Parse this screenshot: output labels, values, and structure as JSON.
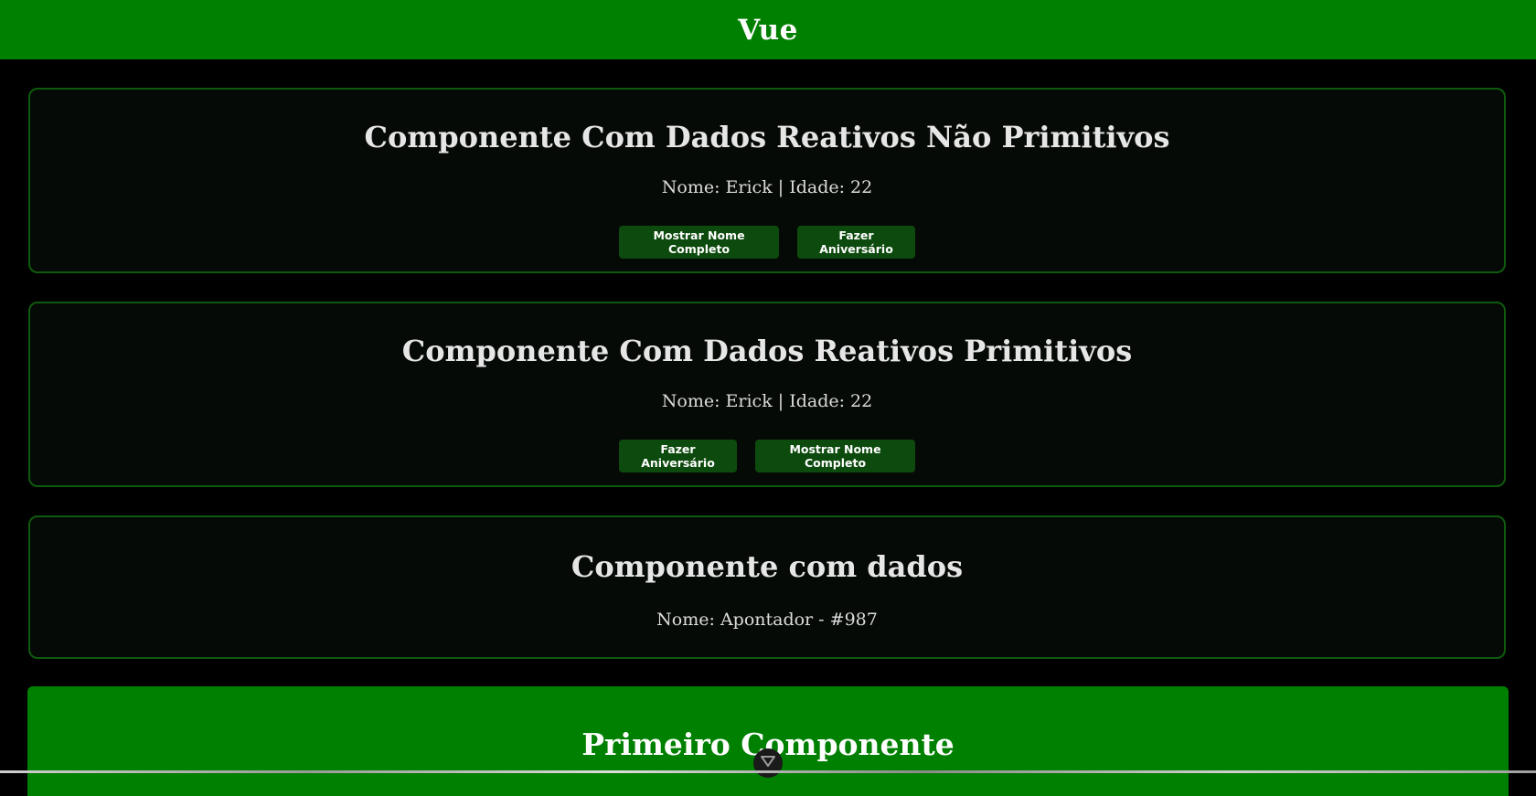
{
  "header": {
    "title": "Vue"
  },
  "cards": [
    {
      "title": "Componente Com Dados Reativos Não Primitivos",
      "info": "Nome: Erick | Idade: 22",
      "buttons": [
        "Mostrar Nome Completo",
        "Fazer Aniversário"
      ]
    },
    {
      "title": "Componente Com Dados Reativos Primitivos",
      "info": "Nome: Erick | Idade: 22",
      "buttons": [
        "Fazer Aniversário",
        "Mostrar Nome Completo"
      ]
    },
    {
      "title": "Componente com dados",
      "info": "Nome: Apontador - #987"
    }
  ],
  "first_component": {
    "title": "Primeiro Componente"
  },
  "icons": {
    "scroll": "chevron-down-icon"
  },
  "colors": {
    "header_bg": "#008000",
    "page_bg": "#000000",
    "card_bg": "#060a06",
    "card_border": "#0e5a0e",
    "button_bg": "#0d4a0d"
  }
}
